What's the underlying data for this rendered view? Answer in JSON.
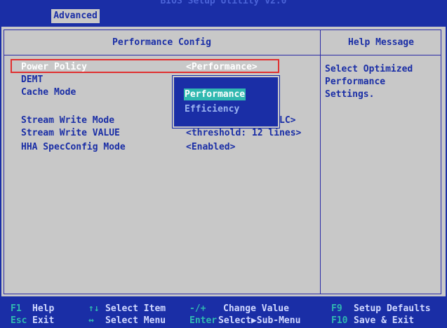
{
  "header": {
    "title": "BIOS Setup Utility v2.0",
    "active_tab": "Advanced"
  },
  "section_title": "Performance Config",
  "help": {
    "title": "Help Message",
    "text": "Select Optimized\nPerformance\nSettings."
  },
  "settings": [
    {
      "label": "Power Policy",
      "value": "<Performance>"
    },
    {
      "label": "DEMT",
      "value": ""
    },
    {
      "label": "Cache Mode",
      "value": ""
    },
    {
      "label": "Stream Write Mode",
      "value": "LC>"
    },
    {
      "label": "Stream Write VALUE",
      "value": "<threshold: 12 lines>"
    },
    {
      "label": "HHA SpecConfig Mode",
      "value": "<Enabled>"
    }
  ],
  "popup": {
    "options": [
      "Performance",
      "Efficiency"
    ],
    "selected": "Performance"
  },
  "footer": {
    "row1": [
      {
        "key": "F1",
        "desc": "Help"
      },
      {
        "key": "↑↓",
        "desc": "Select Item"
      },
      {
        "key": "-/+",
        "desc": "Change Value"
      },
      {
        "key": "F9",
        "desc": "Setup Defaults"
      }
    ],
    "row2": [
      {
        "key": "Esc",
        "desc": "Exit"
      },
      {
        "key": "↔",
        "desc": "Select Menu"
      },
      {
        "key": "Enter",
        "desc": "Select▶Sub-Menu"
      },
      {
        "key": "F10",
        "desc": "Save & Exit"
      }
    ]
  },
  "colors": {
    "background": "#1a2ea6",
    "panel": "#c8c8c8",
    "selection_border": "#e03030",
    "highlight": "#30b8b0"
  }
}
